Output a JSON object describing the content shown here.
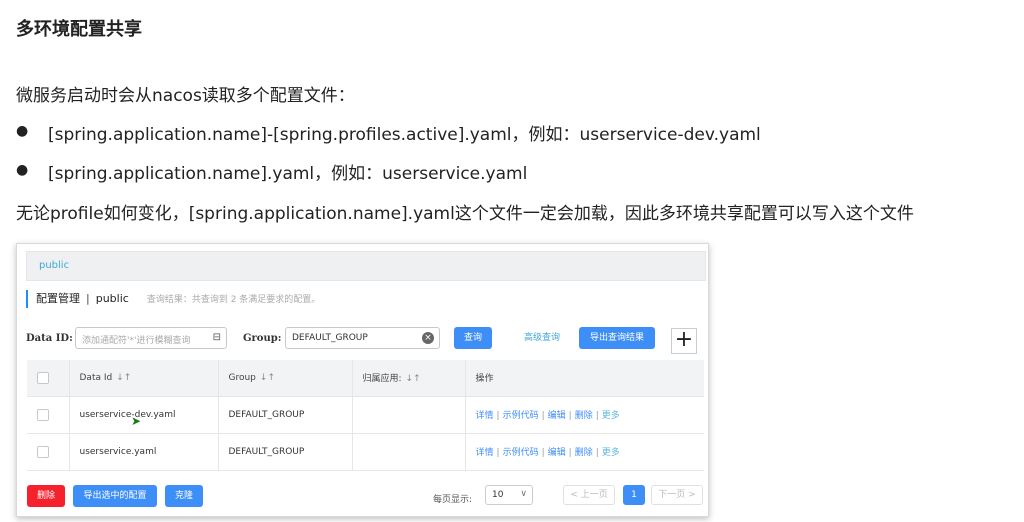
{
  "doc": {
    "title": "多环境配置共享",
    "intro": "微服务启动时会从nacos读取多个配置文件：",
    "bullet_symbol": "●",
    "bullets": [
      "[spring.application.name]-[spring.profiles.active].yaml，例如：userservice-dev.yaml",
      "[spring.application.name].yaml，例如：userservice.yaml"
    ],
    "conclusion": "无论profile如何变化，[spring.application.name].yaml这个文件一定会加载，因此多环境共享配置可以写入这个文件"
  },
  "nacos": {
    "namespace": "public",
    "breadcrumb": {
      "section": "配置管理",
      "separator": "|",
      "namespace": "public",
      "hint": "查询结果：共查询到 2 条满足要求的配置。"
    },
    "search": {
      "data_id_label": "Data ID:",
      "data_id_placeholder": "添加通配符'*'进行模糊查询",
      "group_label": "Group:",
      "group_value": "DEFAULT_GROUP",
      "query_button": "查询",
      "advanced_query": "高级查询",
      "export_results": "导出查询结果",
      "add_button": "+"
    },
    "table": {
      "headers": [
        "Data Id",
        "Group",
        "归属应用:",
        "操作"
      ],
      "sort_icon": "↓↑",
      "rows": [
        {
          "data_id": "userservice-dev.yaml",
          "group": "DEFAULT_GROUP",
          "app": ""
        },
        {
          "data_id": "userservice.yaml",
          "group": "DEFAULT_GROUP",
          "app": ""
        }
      ],
      "actions": [
        "详情",
        "示例代码",
        "编辑",
        "删除",
        "更多"
      ],
      "action_separator": "|"
    },
    "footer": {
      "delete_button": "删除",
      "export_selected": "导出选中的配置",
      "clone_button": "克隆",
      "page_size_label": "每页显示:",
      "page_size_value": "10",
      "prev_page": "< 上一页",
      "current_page": "1",
      "next_page": "下一页 >"
    }
  },
  "colors": {
    "accent_blue": "#3e8ef7",
    "link_blue": "#3fa7d6",
    "danger_red": "#f5222d"
  }
}
